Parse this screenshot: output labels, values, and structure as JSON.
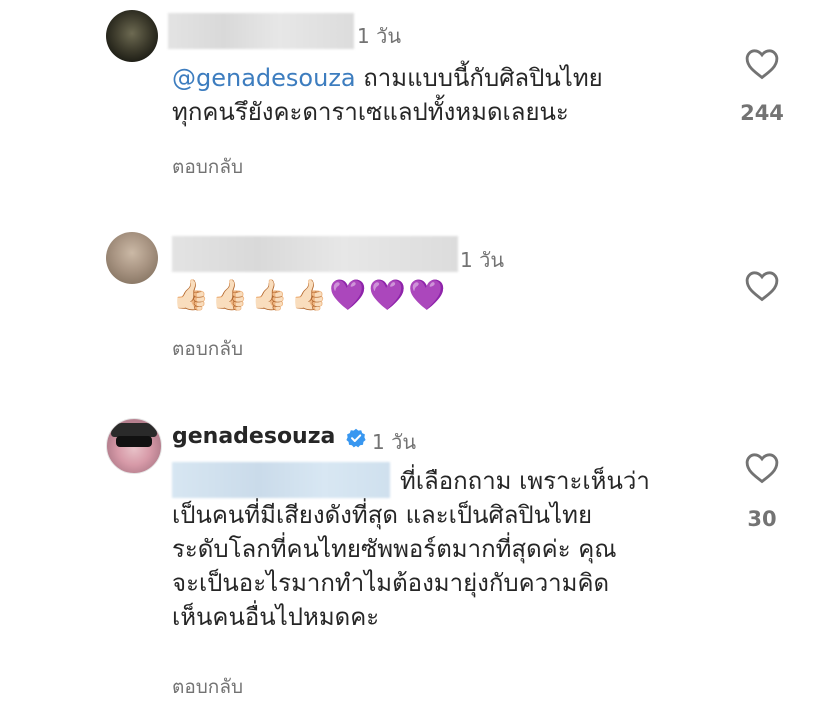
{
  "comments": [
    {
      "time": "1 วัน",
      "mention": "@genadesouza",
      "text_line1": " ถามแบบนี้กับศิลปินไทย",
      "text_line2": "ทุกคนรึยังคะดาราเซแลปทั้งหมดเลยนะ",
      "reply_label": "ตอบกลับ",
      "like_count": "244"
    },
    {
      "time": "1 วัน",
      "emojis": "👍🏻👍🏻👍🏻👍🏻💜💜💜",
      "reply_label": "ตอบกลับ"
    },
    {
      "username": "genadesouza",
      "time": "1 วัน",
      "text_line1": "ที่เลือกถาม เพราะเห็นว่า",
      "text_line2": "เป็นคนที่มีเสียงดังที่สุด และเป็นศิลปินไทย",
      "text_line3": "ระดับโลกที่คนไทยซัพพอร์ตมากที่สุดค่ะ คุณ",
      "text_line4": "จะเป็นอะไรมากทำไมต้องมายุ่งกับความคิด",
      "text_line5": "เห็นคนอื่นไปหมดคะ",
      "reply_label": "ตอบกลับ",
      "like_count": "30"
    }
  ],
  "colors": {
    "text": "#262626",
    "secondary": "#737373",
    "mention": "#3d7dbf",
    "verified": "#3897f0"
  },
  "icons": {
    "like": "heart-outline-icon",
    "verified": "verified-badge-icon"
  }
}
